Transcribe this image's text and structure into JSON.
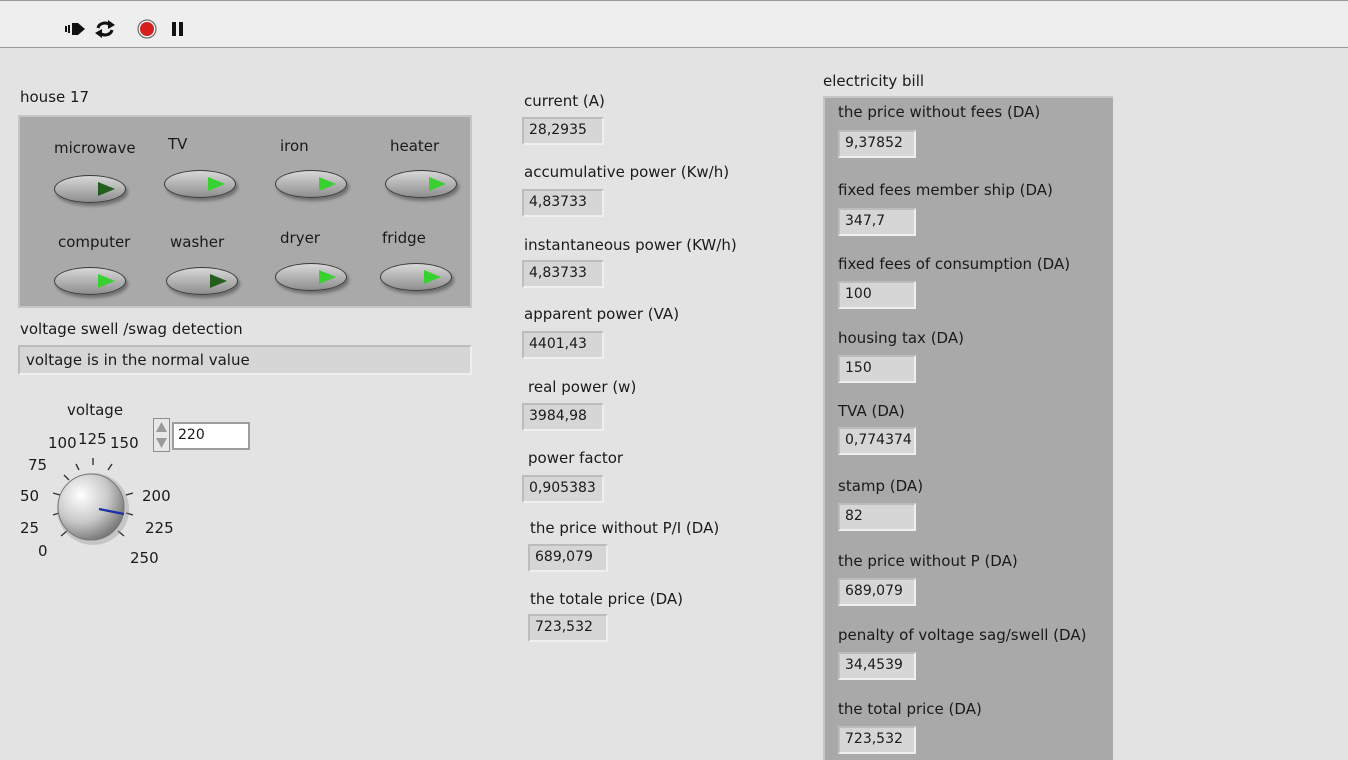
{
  "toolbar": {
    "icons": [
      "run-arrow-icon",
      "run-continuously-icon",
      "abort-stop-icon",
      "pause-icon"
    ],
    "stop_color": "#d61f1f"
  },
  "house": {
    "title": "house 17",
    "appliances": [
      {
        "label": "microwave",
        "on": false
      },
      {
        "label": "TV",
        "on": true
      },
      {
        "label": "iron",
        "on": true
      },
      {
        "label": "heater",
        "on": true
      },
      {
        "label": "computer",
        "on": true
      },
      {
        "label": "washer",
        "on": false
      },
      {
        "label": "dryer",
        "on": true
      },
      {
        "label": "fridge",
        "on": true
      }
    ]
  },
  "detection": {
    "label": "voltage swell /swag detection",
    "message": "voltage is in the normal value"
  },
  "voltage": {
    "label": "voltage",
    "value": "220",
    "ticks": [
      "0",
      "25",
      "50",
      "75",
      "100",
      "125",
      "150",
      "200",
      "225",
      "250"
    ]
  },
  "measurements": [
    {
      "label": "current (A)",
      "value": "28,2935"
    },
    {
      "label": "accumulative power (Kw/h)",
      "value": "4,83733"
    },
    {
      "label": "instantaneous power (KW/h)",
      "value": "4,83733"
    },
    {
      "label": "apparent power (VA)",
      "value": "4401,43"
    },
    {
      "label": "real power (w)",
      "value": "3984,98"
    },
    {
      "label": "power factor",
      "value": "0,905383"
    },
    {
      "label": "the price without P/I (DA)",
      "value": "689,079"
    },
    {
      "label": "the totale price (DA)",
      "value": "723,532"
    }
  ],
  "bill": {
    "title": "electricity bill",
    "items": [
      {
        "label": "the price without fees  (DA)",
        "value": "9,37852"
      },
      {
        "label": "fixed fees member ship (DA)",
        "value": "347,7"
      },
      {
        "label": "fixed fees of consumption (DA)",
        "value": "100"
      },
      {
        "label": "housing tax (DA)",
        "value": "150"
      },
      {
        "label": " TVA (DA)",
        "value": "0,774374"
      },
      {
        "label": "stamp (DA)",
        "value": "82"
      },
      {
        "label": "the price without P (DA)",
        "value": "689,079"
      },
      {
        "label": "penalty of voltage sag/swell  (DA)",
        "value": "34,4539"
      },
      {
        "label": "the total price (DA)",
        "value": "723,532"
      }
    ]
  }
}
